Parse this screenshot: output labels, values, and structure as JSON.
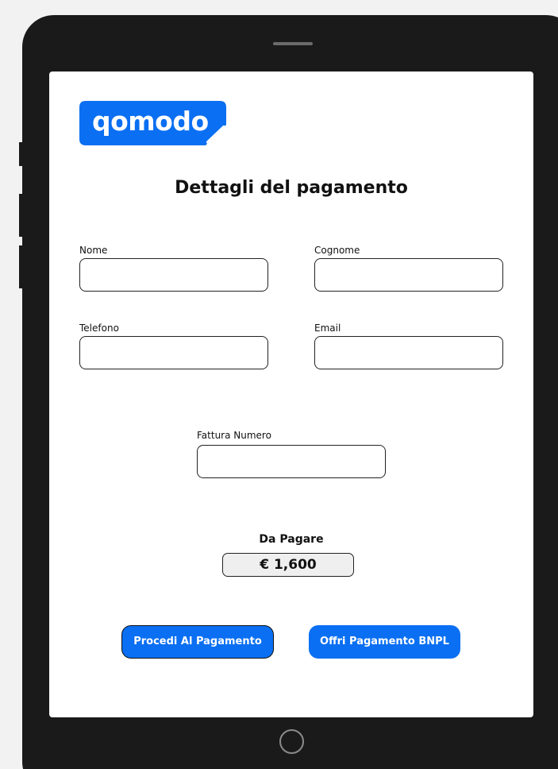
{
  "brand": {
    "logo_text": "qomodo",
    "color": "#0a6ff2"
  },
  "page": {
    "title": "Dettagli del pagamento"
  },
  "form": {
    "nome": {
      "label": "Nome",
      "value": "",
      "placeholder": ""
    },
    "cognome": {
      "label": "Cognome",
      "value": "",
      "placeholder": ""
    },
    "telefono": {
      "label": "Telefono",
      "value": "",
      "placeholder": ""
    },
    "email": {
      "label": "Email",
      "value": "",
      "placeholder": ""
    },
    "fattura": {
      "label": "Fattura Numero",
      "value": "",
      "placeholder": ""
    }
  },
  "payment": {
    "due_label": "Da Pagare",
    "amount": "€ 1,600"
  },
  "actions": {
    "procedi_label": "Procedi Al Pagamento",
    "bnpl_label": "Offri Pagamento BNPL"
  }
}
